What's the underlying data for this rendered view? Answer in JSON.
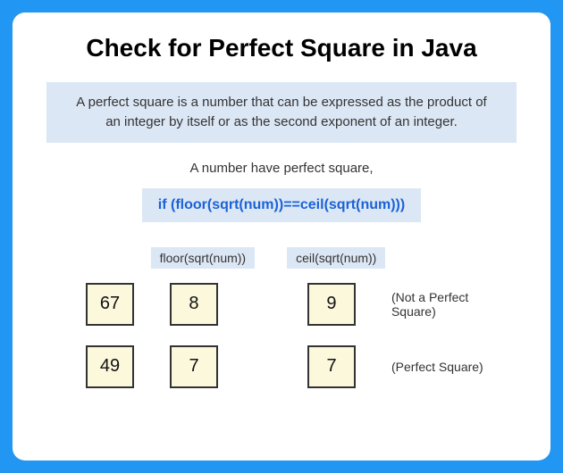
{
  "title": "Check for Perfect Square in Java",
  "definition": "A perfect square is a number that can be expressed as the product of an integer by itself or as the second exponent of an integer.",
  "subheading": "A number have perfect square,",
  "condition": "if (floor(sqrt(num))==ceil(sqrt(num)))",
  "columns": {
    "floor": "floor(sqrt(num))",
    "ceil": "ceil(sqrt(num))"
  },
  "examples": [
    {
      "num": "67",
      "floor": "8",
      "ceil": "9",
      "result": "(Not a Perfect Square)"
    },
    {
      "num": "49",
      "floor": "7",
      "ceil": "7",
      "result": "(Perfect Square)"
    }
  ]
}
